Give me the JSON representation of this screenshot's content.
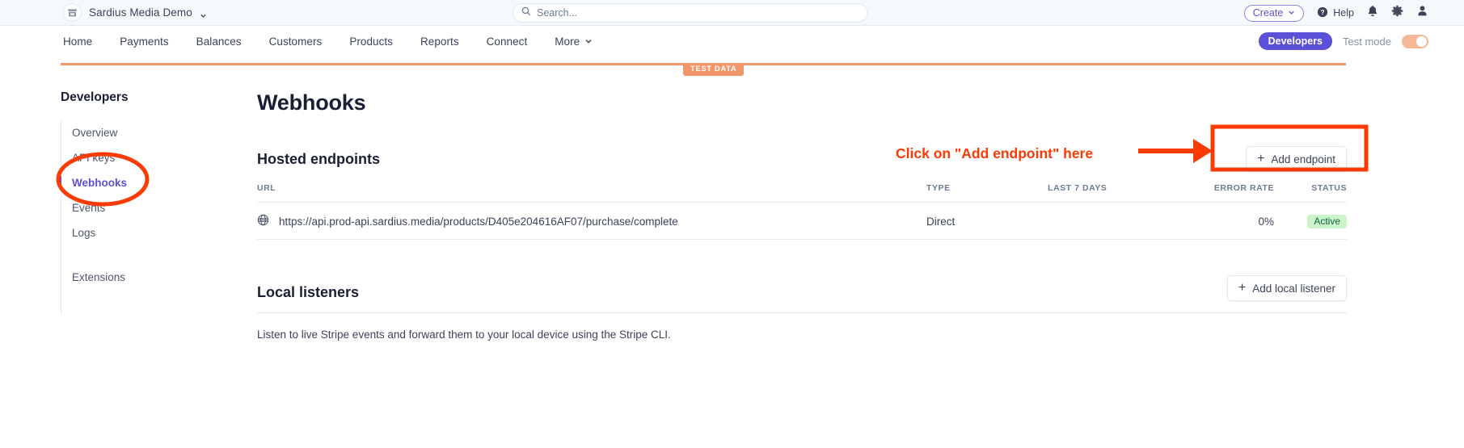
{
  "topbar": {
    "account_name": "Sardius Media Demo",
    "account_icon": "store-icon",
    "account_chevron": "chevron-down-icon",
    "search_placeholder": "Search...",
    "search_value": "",
    "search_icon": "search-icon",
    "create_label": "Create",
    "help_label": "Help",
    "help_icon": "question-circle-icon",
    "notifications_icon": "bell-icon",
    "settings_icon": "gear-icon",
    "account_avatar_icon": "user-icon"
  },
  "nav": {
    "items": [
      {
        "label": "Home"
      },
      {
        "label": "Payments"
      },
      {
        "label": "Balances"
      },
      {
        "label": "Customers"
      },
      {
        "label": "Products"
      },
      {
        "label": "Reports"
      },
      {
        "label": "Connect"
      },
      {
        "label": "More",
        "has_chevron": true
      }
    ],
    "developers_label": "Developers",
    "test_mode_label": "Test mode",
    "test_mode_on": true
  },
  "test_banner": {
    "label": "TEST DATA",
    "color": "#f3956b"
  },
  "sidebar": {
    "title": "Developers",
    "items": [
      {
        "label": "Overview",
        "active": false
      },
      {
        "label": "API keys",
        "active": false
      },
      {
        "label": "Webhooks",
        "active": true
      },
      {
        "label": "Events",
        "active": false
      },
      {
        "label": "Logs",
        "active": false
      }
    ],
    "extensions_label": "Extensions",
    "active_color": "#5b51d8"
  },
  "main": {
    "page_title": "Webhooks",
    "hosted": {
      "title": "Hosted endpoints",
      "add_button_label": "Add endpoint",
      "columns": [
        "URL",
        "TYPE",
        "LAST 7 DAYS",
        "ERROR RATE",
        "STATUS"
      ],
      "rows": [
        {
          "url": "https://api.prod-api.sardius.media/products/D405e204616AF07/purchase/complete",
          "url_icon": "globe-icon",
          "type": "Direct",
          "last_7_days": "",
          "error_rate": "0%",
          "status": "Active"
        }
      ]
    },
    "local": {
      "title": "Local listeners",
      "add_button_label": "Add local listener",
      "description": "Listen to live Stripe events and forward them to your local device using the Stripe CLI."
    }
  },
  "annotations": {
    "instruction_text": "Click on \"Add endpoint\" here",
    "color": "#fc3a04",
    "ellipse_target": "sidebar-item-webhooks",
    "box_target": "add-endpoint-button"
  },
  "colors": {
    "brand_purple": "#5b51d8",
    "test_orange": "#f3956b",
    "annotation_red": "#fc3a04",
    "status_green_bg": "#cbf4c9",
    "status_green_text": "#0e6245"
  }
}
